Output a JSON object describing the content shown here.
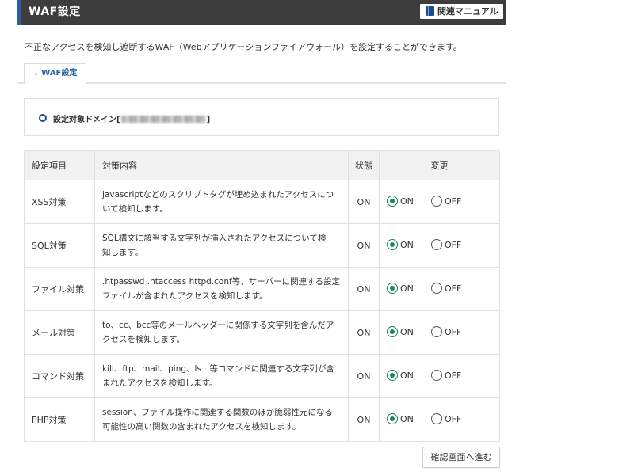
{
  "header": {
    "title": "WAF設定",
    "manual_button": "関連マニュアル"
  },
  "description": "不正なアクセスを検知し遮断するWAF（Webアプリケーションファイアウォール）を設定することができます。",
  "tab": {
    "label": "WAF設定"
  },
  "domain": {
    "label": "設定対象ドメイン[",
    "label_end": "]"
  },
  "table": {
    "headers": {
      "item": "設定項目",
      "content": "対策内容",
      "status": "状態",
      "change": "変更"
    },
    "option_on": "ON",
    "option_off": "OFF",
    "rows": [
      {
        "item": "XSS対策",
        "desc1": "javascriptなどのスクリプトタグが埋め込まれたアクセスにつ",
        "desc2": "いて検知します。",
        "status": "ON",
        "selected": "ON"
      },
      {
        "item": "SQL対策",
        "desc1": "SQL構文に該当する文字列が挿入されたアクセスについて検",
        "desc2": "知します。",
        "status": "ON",
        "selected": "ON"
      },
      {
        "item": "ファイル対策",
        "desc1": ".htpasswd .htaccess httpd.conf等、サーバーに関連する設定",
        "desc2": "ファイルが含まれたアクセスを検知します。",
        "status": "ON",
        "selected": "ON"
      },
      {
        "item": "メール対策",
        "desc1": "to、cc、bcc等のメールヘッダーに関係する文字列を含んだア",
        "desc2": "クセスを検知します。",
        "status": "ON",
        "selected": "ON"
      },
      {
        "item": "コマンド対策",
        "desc1": "kill、ftp、mail、ping、ls　等コマンドに関連する文字列が含",
        "desc2": "まれたアクセスを検知します。",
        "status": "ON",
        "selected": "ON"
      },
      {
        "item": "PHP対策",
        "desc1": "session、ファイル操作に関連する関数のほか脆弱性元になる",
        "desc2": "可能性の高い関数の含まれたアクセスを検知します。",
        "status": "ON",
        "selected": "ON"
      }
    ]
  },
  "confirm_button": "確認画面へ進む",
  "colors": {
    "header_bg": "#3d3d3d",
    "accent_blue": "#2b5ea8",
    "radio_green": "#1a8a64"
  }
}
